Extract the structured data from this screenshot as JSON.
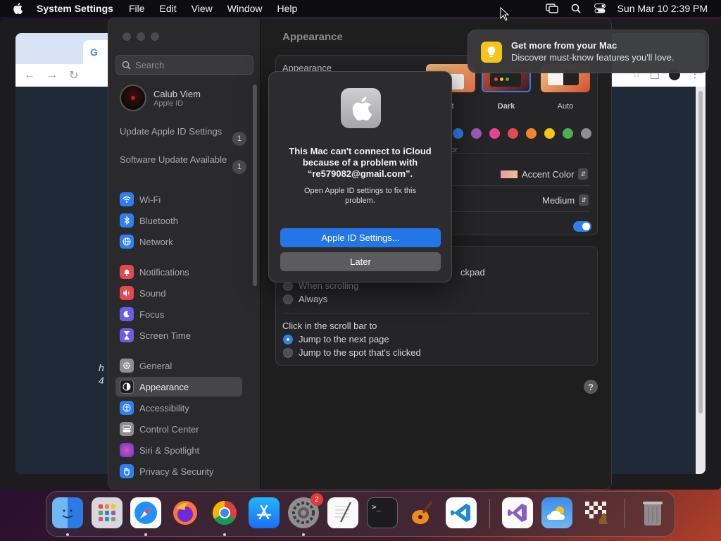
{
  "menubar": {
    "app_name": "System Settings",
    "menus": [
      "File",
      "Edit",
      "View",
      "Window",
      "Help"
    ],
    "clock": "Sun Mar 10  2:39 PM"
  },
  "browser": {
    "tab_logo": "G",
    "snippet_line1": "h",
    "snippet_line2": "4"
  },
  "settings": {
    "search_placeholder": "Search",
    "user": {
      "name": "Calub Viem",
      "subtitle": "Apple ID"
    },
    "notices": [
      {
        "label": "Update Apple ID Settings",
        "count": "1"
      },
      {
        "label": "Software Update Available",
        "count": "1"
      }
    ],
    "nav": [
      {
        "label": "Wi-Fi",
        "icon": "wifi-icon",
        "color": "#2f7ff0"
      },
      {
        "label": "Bluetooth",
        "icon": "bluetooth-icon",
        "color": "#2f7ff0"
      },
      {
        "label": "Network",
        "icon": "globe-icon",
        "color": "#2f7ff0"
      },
      {
        "label": "Notifications",
        "icon": "bell-icon",
        "color": "#e5484d"
      },
      {
        "label": "Sound",
        "icon": "speaker-icon",
        "color": "#e5484d"
      },
      {
        "label": "Focus",
        "icon": "moon-icon",
        "color": "#6e5ce6"
      },
      {
        "label": "Screen Time",
        "icon": "hourglass-icon",
        "color": "#6e5ce6"
      },
      {
        "label": "General",
        "icon": "gear-icon",
        "color": "#8e8e93"
      },
      {
        "label": "Appearance",
        "icon": "appearance-icon",
        "color": "#1c1c1e"
      },
      {
        "label": "Accessibility",
        "icon": "accessibility-icon",
        "color": "#2f7ff0"
      },
      {
        "label": "Control Center",
        "icon": "control-center-icon",
        "color": "#8e8e93"
      },
      {
        "label": "Siri & Spotlight",
        "icon": "siri-icon",
        "color": "#b44be0"
      },
      {
        "label": "Privacy & Security",
        "icon": "hand-icon",
        "color": "#2f7ff0"
      }
    ],
    "main_title": "Appearance",
    "appearance_label": "Appearance",
    "themes": [
      {
        "label": "nt"
      },
      {
        "label": "Dark"
      },
      {
        "label": "Auto"
      }
    ],
    "accent_partial": "or",
    "accent_colors": [
      "#2f7ff0",
      "#9b59b6",
      "#e84393",
      "#e5484d",
      "#f0862a",
      "#f5c518",
      "#4caf50",
      "#8e8e93"
    ],
    "highlight_value": "Accent Color",
    "sidebar_icon_size": "Medium",
    "scrollbar_partial": "ckpad",
    "show_scrollbars_options": [
      "When scrolling",
      "Always"
    ],
    "click_scroll_label": "Click in the scroll bar to",
    "click_scroll_options": [
      "Jump to the next page",
      "Jump to the spot that's clicked"
    ]
  },
  "dialog": {
    "heading": "This Mac can't connect to iCloud because of a problem with “re579082@gmail.com”.",
    "body": "Open Apple ID settings to fix this problem.",
    "primary_button": "Apple ID Settings...",
    "secondary_button": "Later"
  },
  "notification": {
    "title": "Get more from your Mac",
    "body": "Discover must-know features you'll love."
  },
  "dock": {
    "apps": [
      "Finder",
      "Launchpad",
      "Safari",
      "Firefox",
      "Chrome",
      "App Store",
      "System Settings",
      "TextEdit",
      "Terminal",
      "GarageBand",
      "VS Code",
      "Visual Studio",
      "Weather",
      "Chess",
      "Trash"
    ],
    "settings_badge": "2"
  }
}
